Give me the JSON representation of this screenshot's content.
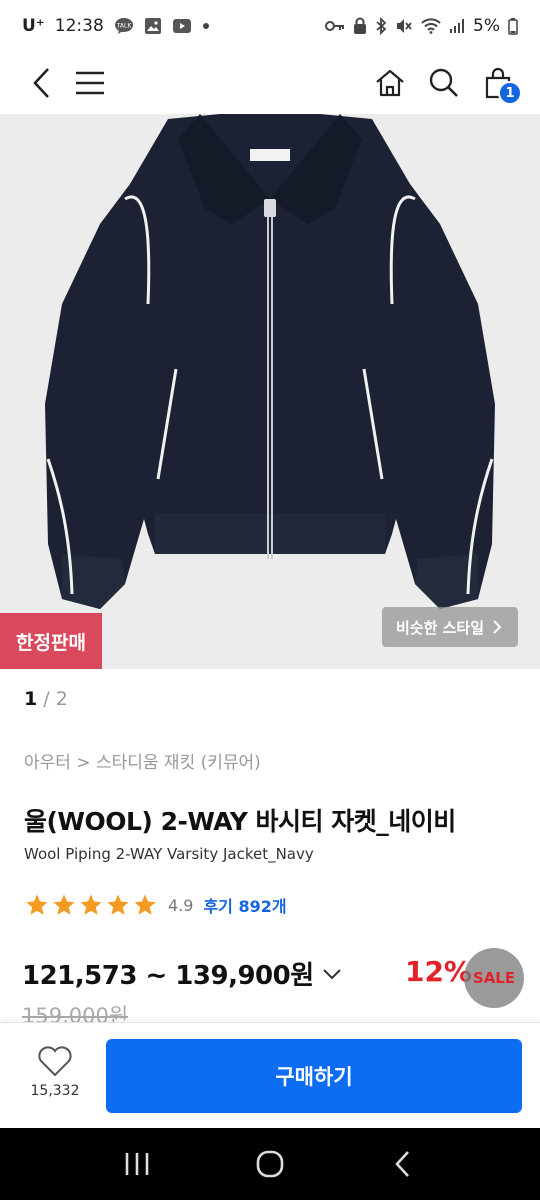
{
  "status_bar": {
    "carrier": "U⁺",
    "time": "12:38",
    "battery": "5%"
  },
  "header": {
    "cart_count": "1"
  },
  "product": {
    "limited_badge": "한정판매",
    "similar_style": "비슷한 스타일",
    "pager_current": "1",
    "pager_total": "/ 2",
    "breadcrumb": "아우터 > 스타디움 재킷 (키뮤어)",
    "title": "울(WOOL) 2-WAY 바시티 자켓_네이비",
    "subtitle": "Wool Piping 2-WAY Varsity Jacket_Navy",
    "rating": "4.9",
    "stars": 5,
    "reviews": "후기 892개",
    "price_range": "121,573 ~ 139,900원",
    "discount": "12%",
    "sale_badge": "SALE",
    "original_price": "159,000원"
  },
  "bottom_bar": {
    "like_count": "15,332",
    "buy_label": "구매하기"
  },
  "colors": {
    "accent": "#0c6cf2",
    "limited": "#d9485b",
    "discount": "#e2222a",
    "star": "#f59a23"
  }
}
